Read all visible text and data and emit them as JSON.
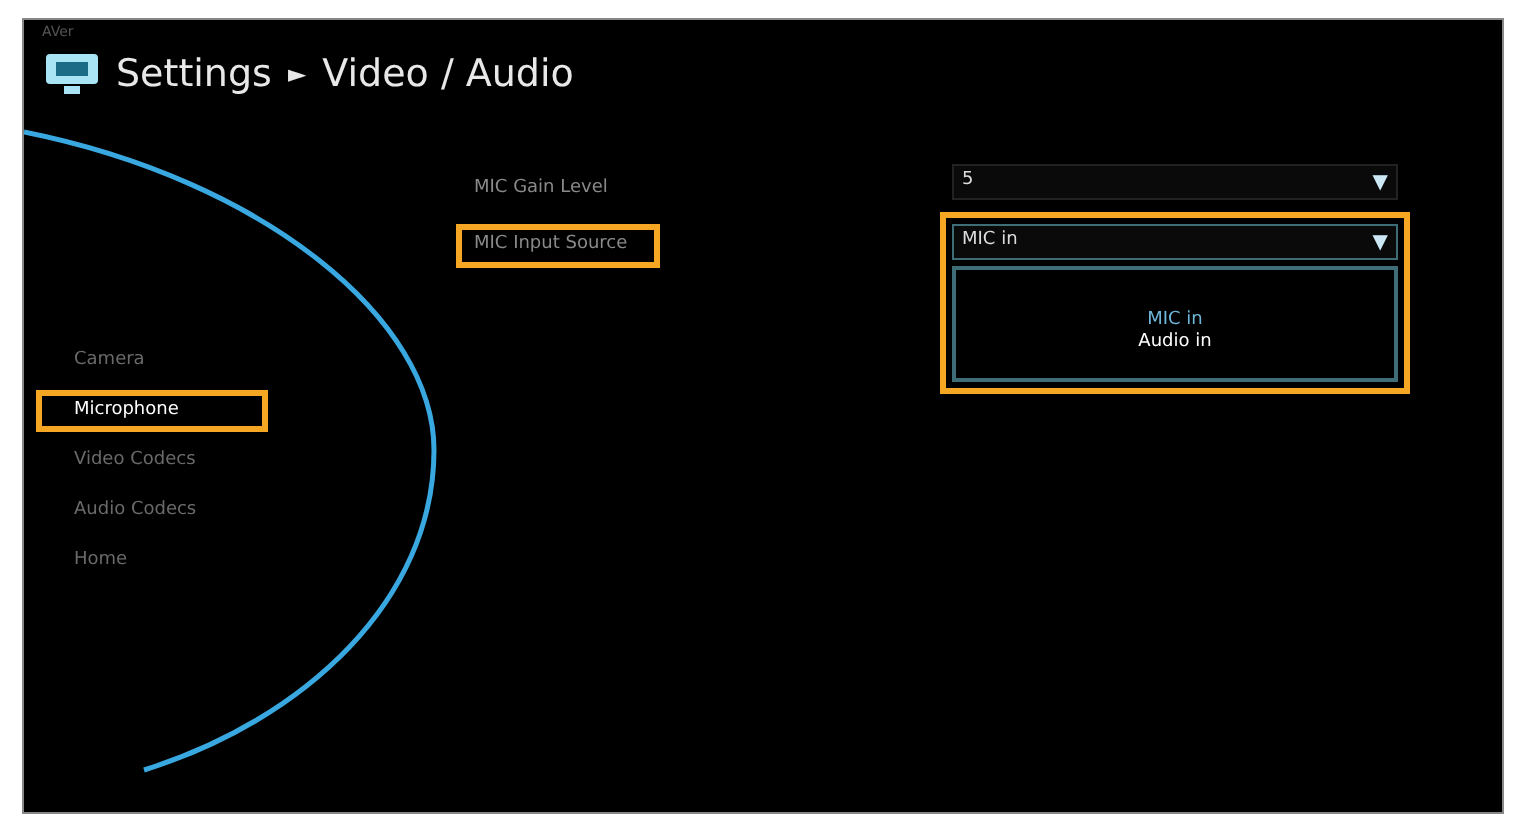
{
  "brand": "AVer",
  "title": {
    "section": "Settings",
    "separator": "►",
    "page": "Video / Audio"
  },
  "sidebar": {
    "items": [
      {
        "label": "Camera",
        "selected": false,
        "highlighted": false
      },
      {
        "label": "Microphone",
        "selected": true,
        "highlighted": true
      },
      {
        "label": "Video Codecs",
        "selected": false,
        "highlighted": false
      },
      {
        "label": "Audio Codecs",
        "selected": false,
        "highlighted": false
      },
      {
        "label": "Home",
        "selected": false,
        "highlighted": false
      }
    ]
  },
  "settings": [
    {
      "label": "MIC Gain Level",
      "value": "5",
      "arrow": "▼",
      "highlighted": false,
      "expanded": false
    },
    {
      "label": "MIC Input Source",
      "value": "MIC in",
      "arrow": "▼",
      "highlighted": true,
      "expanded": true,
      "options": [
        {
          "label": "MIC in",
          "selected": true
        },
        {
          "label": "Audio in",
          "selected": false
        }
      ]
    }
  ]
}
